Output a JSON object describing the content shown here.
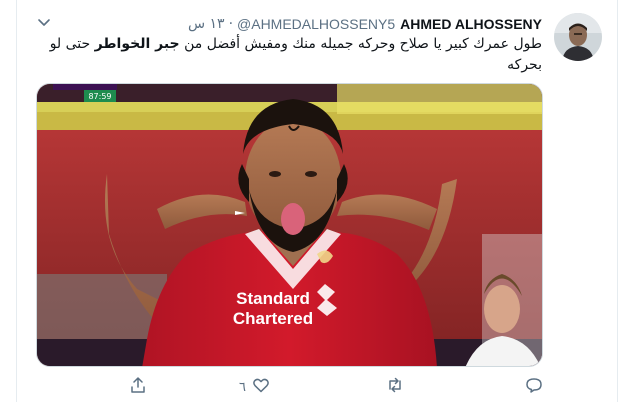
{
  "tweet": {
    "author_name": "AHMED ALHOSSENY",
    "handle": "@AHMEDALHOSSENY5",
    "separator": "·",
    "time": "١٣ س",
    "text_part1": "طول عمرك كبير يا صلاح وحركه جميله منك ومفيش أفضل من ",
    "text_bold": "جبر الخواطر",
    "text_part2": " حتى لو بحركه",
    "media": {
      "scoreboard_time": "87:59",
      "shirt_sponsor_line1": "Standard",
      "shirt_sponsor_line2": "Chartered"
    },
    "actions": {
      "reply_icon": "reply-icon",
      "retweet_icon": "retweet-icon",
      "like_icon": "heart-icon",
      "like_count": "٦",
      "share_icon": "share-icon"
    }
  },
  "colors": {
    "secondary_text": "#5b7083",
    "border": "#e6ecf0",
    "shirt_red": "#d21a2b"
  }
}
